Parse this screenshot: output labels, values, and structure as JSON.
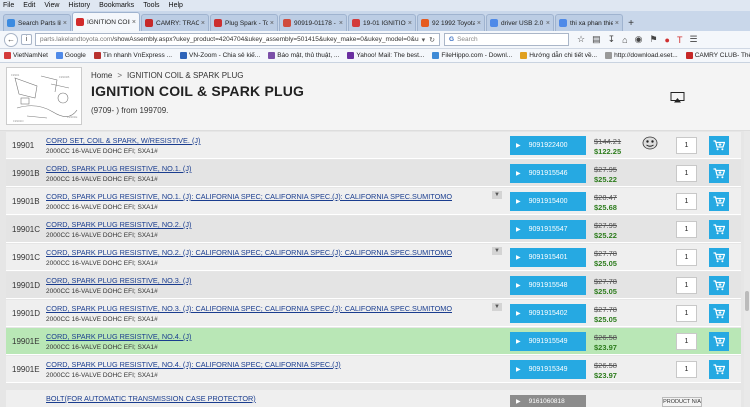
{
  "menu": [
    "File",
    "Edit",
    "View",
    "History",
    "Bookmarks",
    "Tools",
    "Help"
  ],
  "tabs": [
    {
      "label": "Search Parts lik...",
      "color": "#3c8be0",
      "active": false
    },
    {
      "label": "IGNITION COIL ...",
      "color": "#d22b2b",
      "active": true
    },
    {
      "label": "CAMRY: TRAO ...",
      "color": "#c62828",
      "active": false
    },
    {
      "label": "Plug Spark - To...",
      "color": "#cc2f2f",
      "active": false
    },
    {
      "label": "90919-01178 - ...",
      "color": "#d04b3c",
      "active": false
    },
    {
      "label": "19-01 IGNITIO...",
      "color": "#d33b3b",
      "active": false
    },
    {
      "label": "92 1992 Toyota...",
      "color": "#e55a1e",
      "active": false
    },
    {
      "label": "driver USB 2.0 ...",
      "color": "#4f8ae8",
      "active": false
    },
    {
      "label": "thi xa phan thie...",
      "color": "#4f8ae8",
      "active": false
    }
  ],
  "url": {
    "host": "parts.lakelandtoyota.com",
    "path": "/showAssembly.aspx?ukey_product=4204704&ukey_assembly=501415&ukey_make=0&ukey_model=0&u"
  },
  "search": {
    "placeholder": "Search"
  },
  "bookmarks": [
    {
      "label": "VietNamNet",
      "color": "#d33b3b"
    },
    {
      "label": "Google",
      "color": "#4f8ae8"
    },
    {
      "label": "Tin nhanh VnExpress ...",
      "color": "#b8312f"
    },
    {
      "label": "VN-Zoom - Chia sẻ kiế...",
      "color": "#2e63b8"
    },
    {
      "label": "Báo mật, thủ thuật, ...",
      "color": "#7b4fa8"
    },
    {
      "label": "Yahoo! Mail: The best...",
      "color": "#6a2fa0"
    },
    {
      "label": "FileHippo.com - Downl...",
      "color": "#3e8ad6"
    },
    {
      "label": "Hướng dẫn chi tiết về...",
      "color": "#e0a020"
    },
    {
      "label": "http://download.eset...",
      "color": "#999999"
    },
    {
      "label": "CAMRY CLUB- Thế hệ...",
      "color": "#c62828"
    }
  ],
  "page": {
    "breadcrumb_home": "Home",
    "breadcrumb_sep": ">",
    "breadcrumb_current": "IGNITION COIL & SPARK PLUG",
    "title": "IGNITION COIL & SPARK PLUG",
    "subtitle": "(9709- ) from 199709."
  },
  "parts": [
    {
      "ref": "19901",
      "name": "CORD SET, COIL & SPARK, W/RESISTIVE. (J)",
      "desc": "2000CC 16-VALVE DOHC EFI; SXA1#",
      "part_no": "9091922400",
      "list_price": "$144.21",
      "sale_price": "$122.25",
      "qty": "1",
      "caret": false,
      "highlight": false,
      "smiley": true
    },
    {
      "ref": "19901B",
      "name": "CORD, SPARK PLUG RESISTIVE, NO.1. (J)",
      "desc": "2000CC 16-VALVE DOHC EFI; SXA1#",
      "part_no": "9091915546",
      "list_price": "$27.95",
      "sale_price": "$25.22",
      "qty": "1",
      "caret": false,
      "highlight": false,
      "smiley": false
    },
    {
      "ref": "19901B",
      "name": "CORD, SPARK PLUG RESISTIVE, NO.1. (J): CALIFORNIA SPEC; CALIFORNIA SPEC.(J): CALIFORNIA SPEC.SUMITOMO",
      "desc": "2000CC 16-VALVE DOHC EFI; SXA1#",
      "part_no": "9091915400",
      "list_price": "$28.47",
      "sale_price": "$25.68",
      "qty": "1",
      "caret": true,
      "highlight": false,
      "smiley": false
    },
    {
      "ref": "19901C",
      "name": "CORD, SPARK PLUG RESISTIVE, NO.2. (J)",
      "desc": "2000CC 16-VALVE DOHC EFI; SXA1#",
      "part_no": "9091915547",
      "list_price": "$27.95",
      "sale_price": "$25.22",
      "qty": "1",
      "caret": false,
      "highlight": false,
      "smiley": false
    },
    {
      "ref": "19901C",
      "name": "CORD, SPARK PLUG RESISTIVE, NO.2. (J): CALIFORNIA SPEC; CALIFORNIA SPEC.(J): CALIFORNIA SPEC.SUMITOMO",
      "desc": "2000CC 16-VALVE DOHC EFI; SXA1#",
      "part_no": "9091915401",
      "list_price": "$27.78",
      "sale_price": "$25.05",
      "qty": "1",
      "caret": true,
      "highlight": false,
      "smiley": false
    },
    {
      "ref": "19901D",
      "name": "CORD, SPARK PLUG RESISTIVE, NO.3. (J)",
      "desc": "2000CC 16-VALVE DOHC EFI; SXA1#",
      "part_no": "9091915548",
      "list_price": "$27.78",
      "sale_price": "$25.05",
      "qty": "1",
      "caret": false,
      "highlight": false,
      "smiley": false
    },
    {
      "ref": "19901D",
      "name": "CORD, SPARK PLUG RESISTIVE, NO.3. (J): CALIFORNIA SPEC; CALIFORNIA SPEC.(J): CALIFORNIA SPEC.SUMITOMO",
      "desc": "2000CC 16-VALVE DOHC EFI; SXA1#",
      "part_no": "9091915402",
      "list_price": "$27.78",
      "sale_price": "$25.05",
      "qty": "1",
      "caret": true,
      "highlight": false,
      "smiley": false
    },
    {
      "ref": "19901E",
      "name": "CORD, SPARK PLUG RESISTIVE, NO.4. (J)",
      "desc": "2000CC 16-VALVE DOHC EFI; SXA1#",
      "part_no": "9091915549",
      "list_price": "$26.58",
      "sale_price": "$23.97",
      "qty": "1",
      "caret": false,
      "highlight": true,
      "smiley": false
    },
    {
      "ref": "19901E",
      "name": "CORD, SPARK PLUG RESISTIVE, NO.4. (J): CALIFORNIA SPEC; CALIFORNIA SPEC.(J)",
      "desc": "2000CC 16-VALVE DOHC EFI; SXA1#",
      "part_no": "9091915349",
      "list_price": "$26.58",
      "sale_price": "$23.97",
      "qty": "1",
      "caret": false,
      "highlight": false,
      "smiley": false
    }
  ],
  "last_part": {
    "name": "BOLT(FOR AUTOMATIC TRANSMISSION CASE PROTECTOR)",
    "part_no": "9161060818",
    "button": "PRODUCT N/A"
  },
  "colors": {
    "accent": "#26a9e2",
    "highlight_row": "#b9e7b6",
    "sale": "#2e7d1e",
    "link": "#1a3d8f"
  }
}
